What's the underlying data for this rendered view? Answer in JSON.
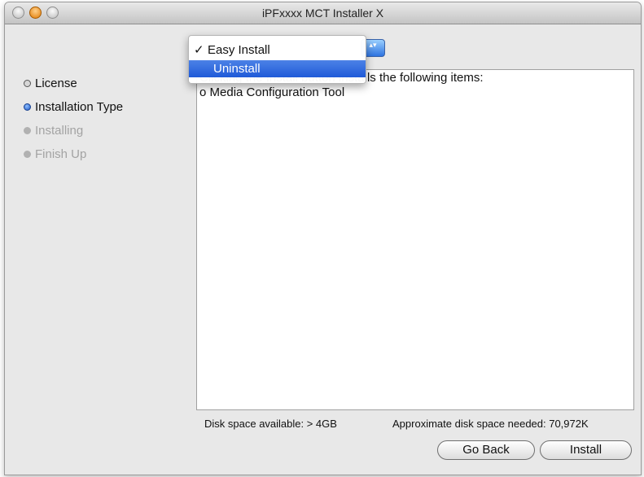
{
  "window": {
    "title": "iPFxxxx  MCT Installer X",
    "controls": [
      "close-button",
      "minimize-button",
      "zoom-button"
    ]
  },
  "steps": [
    {
      "label": "License",
      "state": "done"
    },
    {
      "label": "Installation Type",
      "state": "current"
    },
    {
      "label": "Installing",
      "state": "pending"
    },
    {
      "label": "Finish Up",
      "state": "pending"
    }
  ],
  "install_type_menu": {
    "items": [
      {
        "label": "Easy Install",
        "checked": true,
        "check_glyph": "✓"
      },
      {
        "label": "Uninstall",
        "highlighted": true
      }
    ],
    "stepper_arrows": "▴▾"
  },
  "content": {
    "line1": "Clicking the Install button installs the following items:",
    "line2": "o Media Configuration Tool"
  },
  "disk": {
    "available": "Disk space available: > 4GB",
    "needed": "Approximate disk space needed: 70,972K"
  },
  "buttons": {
    "go_back": "Go Back",
    "install": "Install"
  },
  "colors": {
    "accent": "#2d73e0",
    "menu_highlight": "#1f5ad8"
  }
}
